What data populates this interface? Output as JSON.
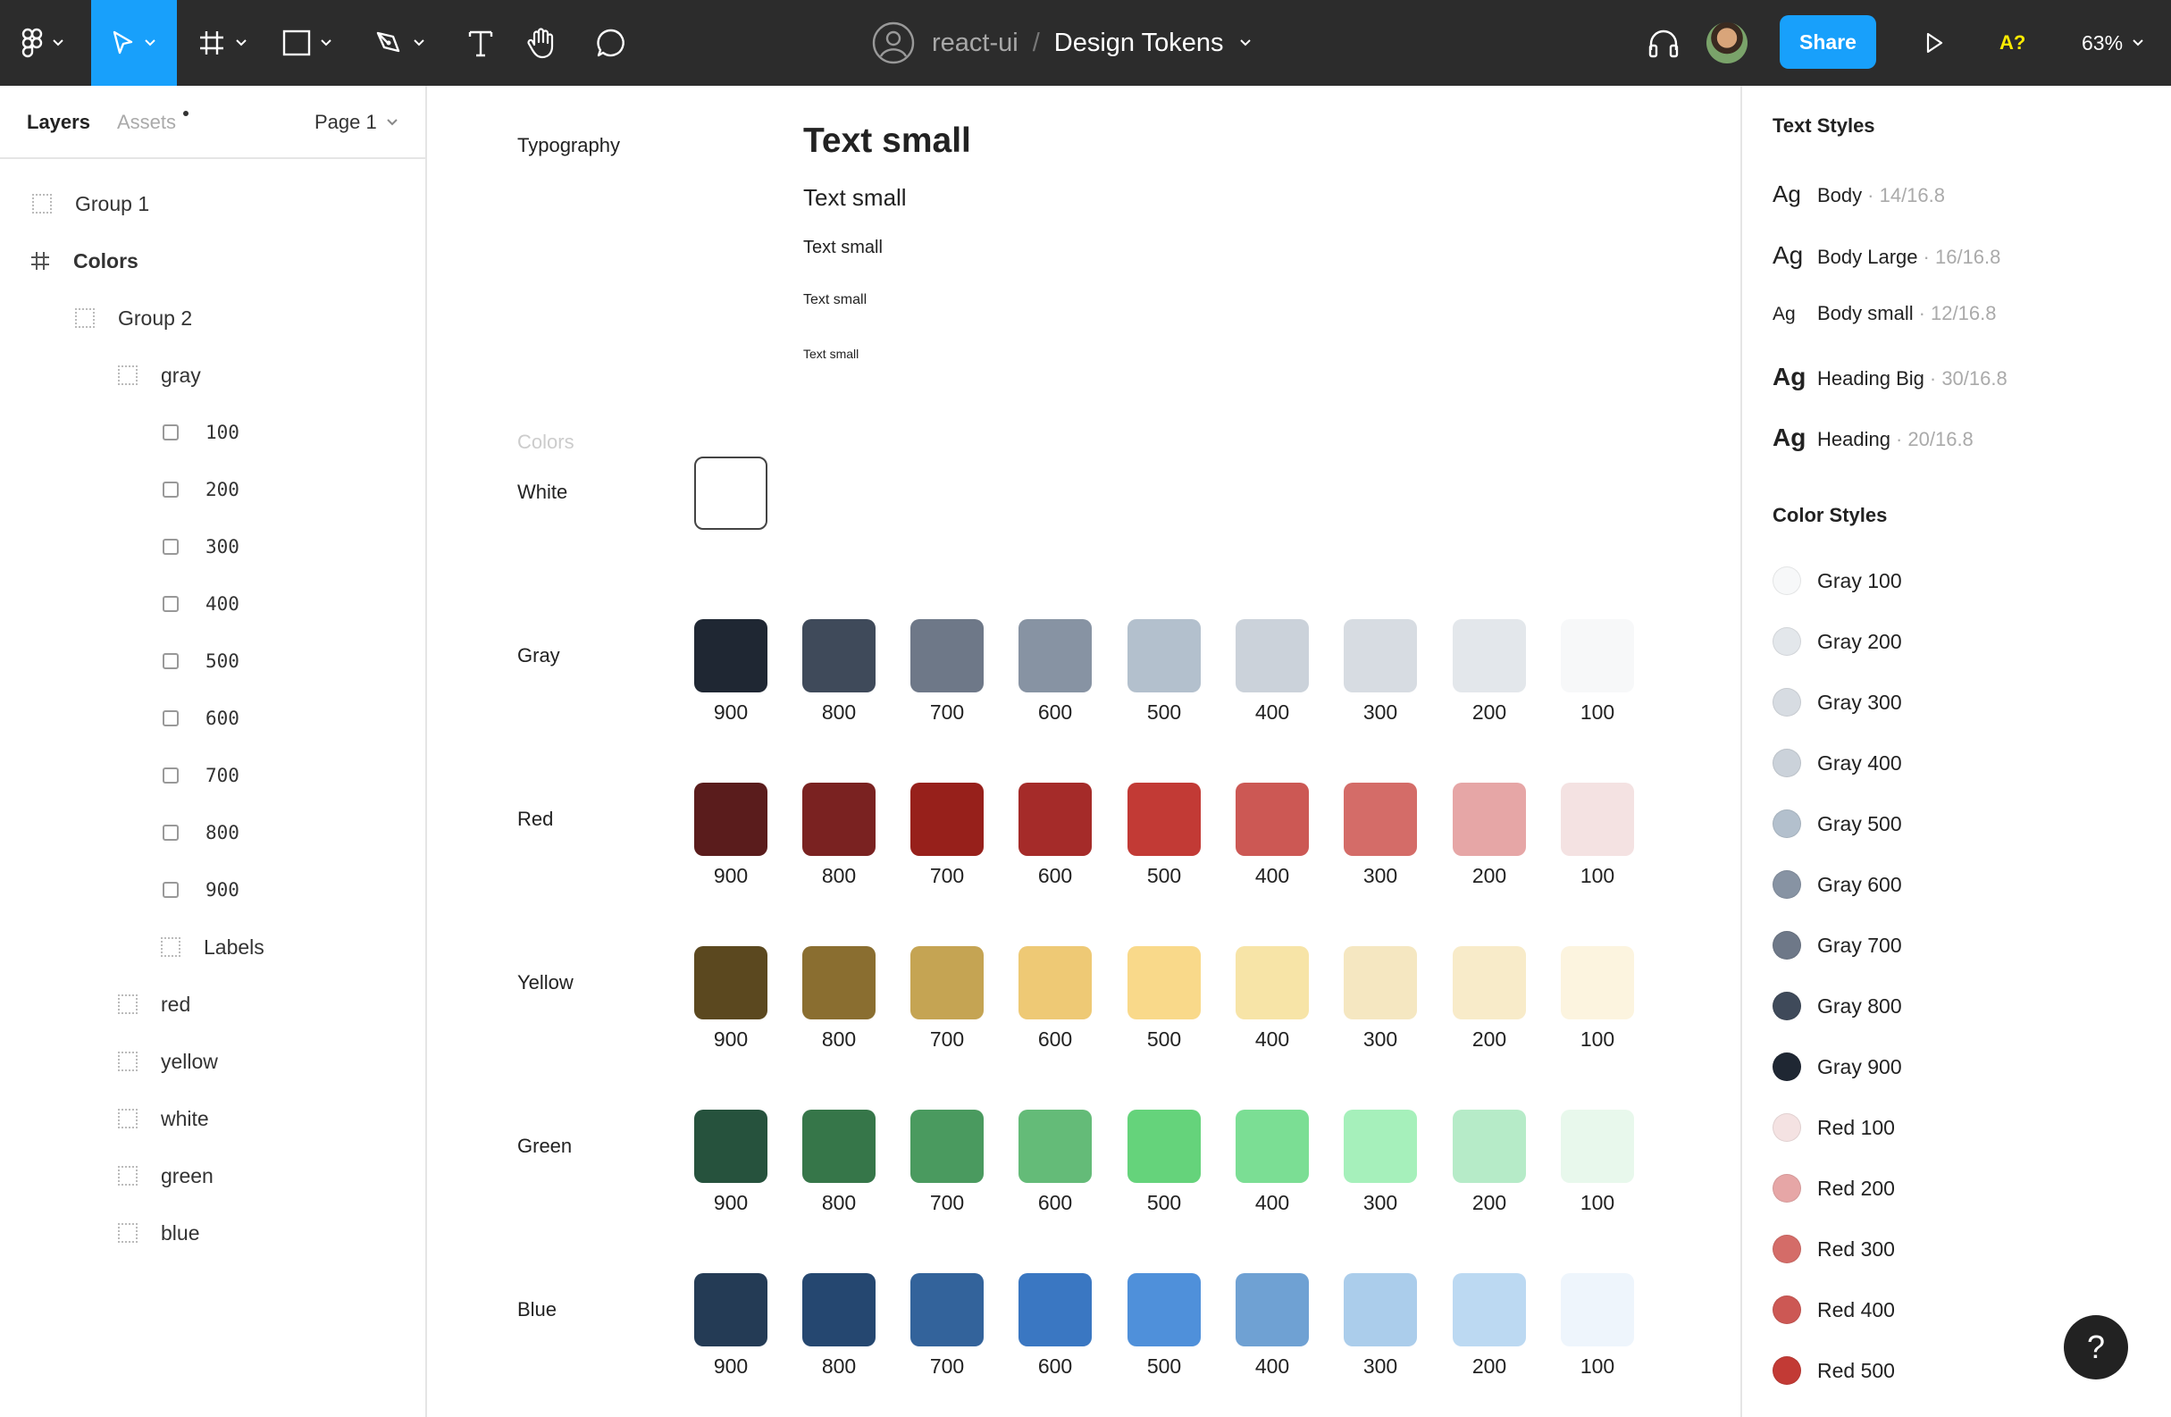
{
  "toolbar": {
    "project": "react-ui",
    "separator": "/",
    "file_name": "Design Tokens",
    "share_label": "Share",
    "font_warning": "A?",
    "zoom": "63%"
  },
  "left_panel": {
    "tab_layers": "Layers",
    "tab_assets": "Assets",
    "page": "Page 1",
    "layers": [
      {
        "label": "Group 1",
        "icon": "group-icon"
      },
      {
        "label": "Colors",
        "icon": "frame-icon"
      },
      {
        "label": "Group 2",
        "icon": "group-icon"
      },
      {
        "label": "gray",
        "icon": "group-icon"
      },
      {
        "label": "100",
        "icon": "rectangle-icon"
      },
      {
        "label": "200",
        "icon": "rectangle-icon"
      },
      {
        "label": "300",
        "icon": "rectangle-icon"
      },
      {
        "label": "400",
        "icon": "rectangle-icon"
      },
      {
        "label": "500",
        "icon": "rectangle-icon"
      },
      {
        "label": "600",
        "icon": "rectangle-icon"
      },
      {
        "label": "700",
        "icon": "rectangle-icon"
      },
      {
        "label": "800",
        "icon": "rectangle-icon"
      },
      {
        "label": "900",
        "icon": "rectangle-icon"
      },
      {
        "label": "Labels",
        "icon": "group-icon"
      },
      {
        "label": "red",
        "icon": "group-icon"
      },
      {
        "label": "yellow",
        "icon": "group-icon"
      },
      {
        "label": "white",
        "icon": "group-icon"
      },
      {
        "label": "green",
        "icon": "group-icon"
      },
      {
        "label": "blue",
        "icon": "group-icon"
      }
    ]
  },
  "canvas": {
    "typography_label": "Typography",
    "type_samples": [
      "Text small",
      "Text small",
      "Text small",
      "Text small",
      "Text small"
    ],
    "colors_label": "Colors",
    "white_label": "White",
    "shade_labels": [
      "900",
      "800",
      "700",
      "600",
      "500",
      "400",
      "300",
      "200",
      "100"
    ],
    "palettes": [
      {
        "name": "Gray",
        "colors": [
          "#1f2733",
          "#3f4a5a",
          "#6e7888",
          "#8793a3",
          "#b3c0cd",
          "#cbd2da",
          "#d7dce2",
          "#e3e7eb",
          "#f7f8f9"
        ]
      },
      {
        "name": "Red",
        "colors": [
          "#5a1c1c",
          "#7a2221",
          "#97201b",
          "#a52b29",
          "#c23a35",
          "#cc5854",
          "#d46c68",
          "#e6a6a6",
          "#f4e2e2"
        ]
      },
      {
        "name": "Yellow",
        "colors": [
          "#5b481f",
          "#8a6e30",
          "#c5a453",
          "#eec975",
          "#f9d98a",
          "#f7e4a7",
          "#f5e7c1",
          "#f8ebc9",
          "#fcf4df"
        ]
      },
      {
        "name": "Green",
        "colors": [
          "#26523d",
          "#367649",
          "#4a9a5f",
          "#64bb78",
          "#65d37b",
          "#7bde94",
          "#a6f0bb",
          "#b6ebc8",
          "#e8f8ec"
        ]
      },
      {
        "name": "Blue",
        "colors": [
          "#243b55",
          "#254770",
          "#33639b",
          "#3a77c2",
          "#4f90da",
          "#6fa1d3",
          "#abcdeb",
          "#bcd9f2",
          "#eef5fc"
        ]
      }
    ]
  },
  "right_panel": {
    "text_styles_title": "Text Styles",
    "text_styles": [
      {
        "ag": "Ag",
        "name": "Body",
        "meta": "· 14/16.8"
      },
      {
        "ag": "Ag",
        "name": "Body Large",
        "meta": "· 16/16.8"
      },
      {
        "ag": "Ag",
        "name": "Body small",
        "meta": "· 12/16.8"
      },
      {
        "ag": "Ag",
        "name": "Heading Big",
        "meta": "· 30/16.8"
      },
      {
        "ag": "Ag",
        "name": "Heading",
        "meta": "· 20/16.8"
      }
    ],
    "color_styles_title": "Color Styles",
    "color_styles": [
      {
        "name": "Gray 100",
        "color": "#f7f8f9"
      },
      {
        "name": "Gray 200",
        "color": "#e3e7eb"
      },
      {
        "name": "Gray 300",
        "color": "#d7dce2"
      },
      {
        "name": "Gray 400",
        "color": "#cbd2da"
      },
      {
        "name": "Gray 500",
        "color": "#b3c0cd"
      },
      {
        "name": "Gray 600",
        "color": "#8793a3"
      },
      {
        "name": "Gray 700",
        "color": "#6e7888"
      },
      {
        "name": "Gray 800",
        "color": "#3f4a5a"
      },
      {
        "name": "Gray 900",
        "color": "#1f2733"
      },
      {
        "name": "Red 100",
        "color": "#f4e2e2"
      },
      {
        "name": "Red 200",
        "color": "#e6a6a6"
      },
      {
        "name": "Red 300",
        "color": "#d46c68"
      },
      {
        "name": "Red 400",
        "color": "#cc5854"
      },
      {
        "name": "Red 500",
        "color": "#c23a35"
      }
    ],
    "help": "?"
  }
}
